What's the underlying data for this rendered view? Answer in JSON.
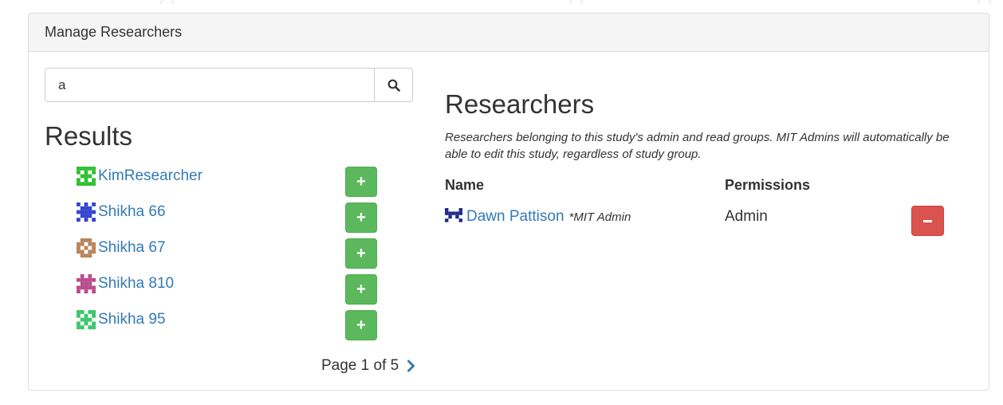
{
  "panel": {
    "heading": "Manage Researchers"
  },
  "search": {
    "value": "a",
    "button_icon": "search-icon"
  },
  "results": {
    "title": "Results",
    "items": [
      {
        "name": "KimResearcher",
        "identicon_color": "#2fbf2f"
      },
      {
        "name": "Shikha 66",
        "identicon_color": "#3344cc"
      },
      {
        "name": "Shikha 67",
        "identicon_color": "#b8835a"
      },
      {
        "name": "Shikha 810",
        "identicon_color": "#b84c8c"
      },
      {
        "name": "Shikha 95",
        "identicon_color": "#3ac66a"
      }
    ],
    "add_label": "+",
    "page_text": "Page 1 of 5"
  },
  "researchers": {
    "title": "Researchers",
    "description": "Researchers belonging to this study's admin and read groups. MIT Admins will automatically be able to edit this study, regardless of study group.",
    "columns": {
      "name": "Name",
      "permissions": "Permissions"
    },
    "rows": [
      {
        "name": "Dawn Pattison",
        "tag": "*MIT Admin",
        "permission": "Admin",
        "identicon_color": "#1f2a8a"
      }
    ]
  },
  "colors": {
    "link": "#337ab7",
    "success": "#5cb85c",
    "danger": "#d9534f"
  }
}
